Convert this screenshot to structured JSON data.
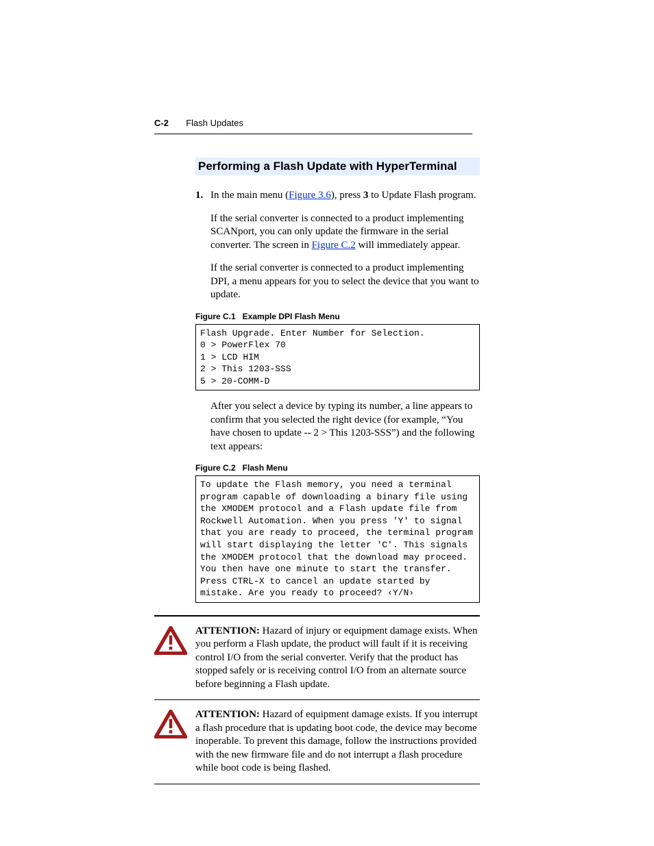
{
  "header": {
    "page_number": "C-2",
    "chapter": "Flash Updates"
  },
  "section_title": "Performing a Flash Update with HyperTerminal",
  "step1": {
    "num": "1.",
    "pre": "In the main menu (",
    "link": "Figure 3.6",
    "post": "), press ",
    "bold": "3",
    "tail": " to Update Flash program."
  },
  "p1": {
    "pre": "If the serial converter is connected to a product implementing SCANport, you can only update the firmware in the serial converter. The screen in ",
    "link": "Figure C.2",
    "post": " will immediately appear."
  },
  "p2": "If the serial converter is connected to a product implementing DPI, a menu appears for you to select the device that you want to update.",
  "fig1": {
    "label": "Figure C.1   Example DPI Flash Menu",
    "code": "Flash Upgrade. Enter Number for Selection.\n0 > PowerFlex 70\n1 > LCD HIM\n2 > This 1203-SSS\n5 > 20-COMM-D"
  },
  "p3": "After you select a device by typing its number, a line appears to confirm that you selected the right device (for example, “You have chosen to update -- 2 > This 1203-SSS”) and the following text appears:",
  "fig2": {
    "label": "Figure C.2   Flash Menu",
    "code": "To update the Flash memory, you need a terminal program capable of downloading a binary file using the XMODEM protocol and a Flash update file from Rockwell Automation. When you press 'Y' to signal that you are ready to proceed, the terminal program will start displaying the letter 'C'. This signals the XMODEM protocol that the download may proceed. You then have one minute to start the transfer. Press CTRL-X to cancel an update started by mistake. Are you ready to proceed? ‹Y/N›"
  },
  "attention1": {
    "lead": "ATTENTION:",
    "text": "  Hazard of injury or equipment damage exists. When you perform a Flash update, the product will fault if it is receiving control I/O from the serial converter. Verify that the product has stopped safely or is receiving control I/O from an alternate source before beginning a Flash update."
  },
  "attention2": {
    "lead": "ATTENTION:",
    "text": "  Hazard of equipment damage exists. If you interrupt a flash procedure that is updating boot code, the device may become inoperable. To prevent this damage, follow the instructions provided with the new firmware file and do not interrupt a flash procedure while boot code is being flashed."
  }
}
